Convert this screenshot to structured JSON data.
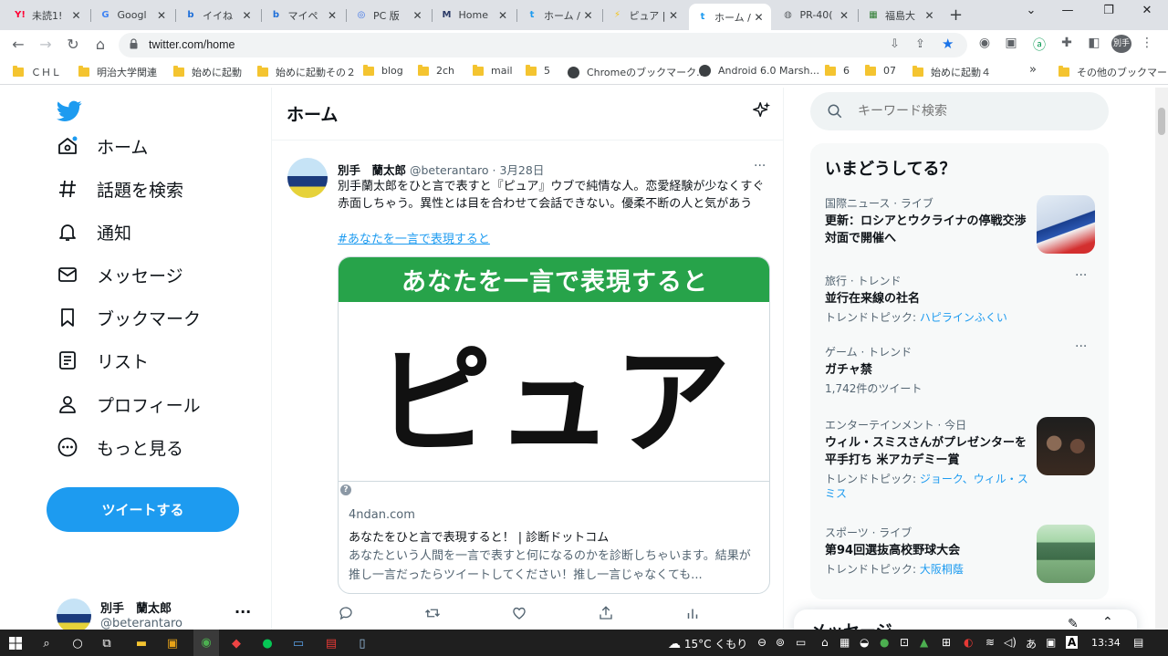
{
  "browser": {
    "tabs": [
      {
        "label": "未読1!",
        "icon": "Y!",
        "icon_color": "#ff0033",
        "active": false
      },
      {
        "label": "Googl",
        "icon": "G",
        "icon_color": "#4285f4",
        "active": false
      },
      {
        "label": "イイね",
        "icon": "b",
        "icon_color": "#1e6fd9",
        "active": false
      },
      {
        "label": "マイペ",
        "icon": "b",
        "icon_color": "#1e6fd9",
        "active": false
      },
      {
        "label": "PC 版",
        "icon": "◎",
        "icon_color": "#3b73e8",
        "active": false
      },
      {
        "label": "Home",
        "icon": "M",
        "icon_color": "#2b3a67",
        "active": false
      },
      {
        "label": "ホーム /",
        "icon": "t",
        "icon_color": "#1d9bf0",
        "active": false
      },
      {
        "label": "ピュア |",
        "icon": "⚡",
        "icon_color": "#f5c518",
        "active": false
      },
      {
        "label": "ホーム /",
        "icon": "t",
        "icon_color": "#1d9bf0",
        "active": true
      },
      {
        "label": "PR-40(",
        "icon": "◍",
        "icon_color": "#5f6368",
        "active": false
      },
      {
        "label": "福島大",
        "icon": "▦",
        "icon_color": "#2e7d32",
        "active": false
      }
    ],
    "url": "twitter.com/home",
    "bookmarks": [
      {
        "label": "ＣＨＬ",
        "kind": "folder"
      },
      {
        "label": "明治大学関連",
        "kind": "folder"
      },
      {
        "label": "始めに起動",
        "kind": "folder"
      },
      {
        "label": "始めに起動その２",
        "kind": "folder"
      },
      {
        "label": "blog",
        "kind": "folder"
      },
      {
        "label": "2ch",
        "kind": "folder"
      },
      {
        "label": "mail",
        "kind": "folder"
      },
      {
        "label": "5",
        "kind": "folder"
      },
      {
        "label": "Chromeのブックマーク...",
        "kind": "site"
      },
      {
        "label": "Android 6.0 Marsh...",
        "kind": "site"
      },
      {
        "label": "6",
        "kind": "folder"
      },
      {
        "label": "07",
        "kind": "folder"
      },
      {
        "label": "始めに起動４",
        "kind": "folder"
      }
    ],
    "bookmarks_more": "»",
    "other_bookmarks": "その他のブックマーク",
    "profile_label": "別手"
  },
  "twitter": {
    "nav": [
      {
        "label": "ホーム",
        "icon": "home-icon"
      },
      {
        "label": "話題を検索",
        "icon": "hashtag-icon"
      },
      {
        "label": "通知",
        "icon": "bell-icon"
      },
      {
        "label": "メッセージ",
        "icon": "mail-icon"
      },
      {
        "label": "ブックマーク",
        "icon": "bookmark-icon"
      },
      {
        "label": "リスト",
        "icon": "list-icon"
      },
      {
        "label": "プロフィール",
        "icon": "person-icon"
      },
      {
        "label": "もっと見る",
        "icon": "more-circle-icon"
      }
    ],
    "tweet_button": "ツイートする",
    "account": {
      "name": "別手　蘭太郎",
      "handle": "@beterantaro"
    },
    "page_title": "ホーム",
    "tweet": {
      "name": "別手　蘭太郎",
      "handle": "@beterantaro",
      "separator": "·",
      "date": "3月28日",
      "text": "別手蘭太郎をひと言で表すと『ピュア』ウブで純情な人。恋愛経験が少なくすぐ赤面しちゃう。異性とは目を合わせて会話できない。優柔不断の人と気があう",
      "hashtag": "#あなたを一言で表現すると",
      "card": {
        "banner": "あなたを一言で表現すると",
        "image_text": "ピュア",
        "domain": "4ndan.com",
        "title": "あなたをひと言で表現すると！ | 診断ドットコム",
        "description": "あなたという人間を一言で表すと何になるのかを診断しちゃいます。結果が推し一言だったらツイートしてください！推し一言じゃなくても..."
      }
    },
    "search_placeholder": "キーワード検索",
    "trends_title": "いまどうしてる？",
    "trends": [
      {
        "context": "国際ニュース · ライブ",
        "title": "更新：ロシアとウクライナの停戦交渉 対面で開催へ",
        "sub": "",
        "links": "",
        "image": "news-image"
      },
      {
        "context": "旅行 · トレンド",
        "title": "並行在来線の社名",
        "sub": "トレンドトピック: ",
        "links": "ハピラインふくい",
        "image": ""
      },
      {
        "context": "ゲーム · トレンド",
        "title": "ガチャ禁",
        "sub": "1,742件のツイート",
        "links": "",
        "image": ""
      },
      {
        "context": "エンターテインメント · 今日",
        "title": "ウィル・スミスさんがプレゼンターを平手打ち 米アカデミー賞",
        "sub": "トレンドトピック: ",
        "links": "ジョーク、ウィル・スミス",
        "image": "entertainment-image"
      },
      {
        "context": "スポーツ · ライブ",
        "title": "第94回選抜高校野球大会",
        "sub": "トレンドトピック: ",
        "links": "大阪桐蔭",
        "image": "stadium-image"
      }
    ],
    "messages_drawer": "メッセージ"
  },
  "taskbar": {
    "weather": "15°C くもり",
    "time": "13:34"
  },
  "colors": {
    "twitter_blue": "#1d9bf0",
    "card_green": "#27a34a"
  }
}
